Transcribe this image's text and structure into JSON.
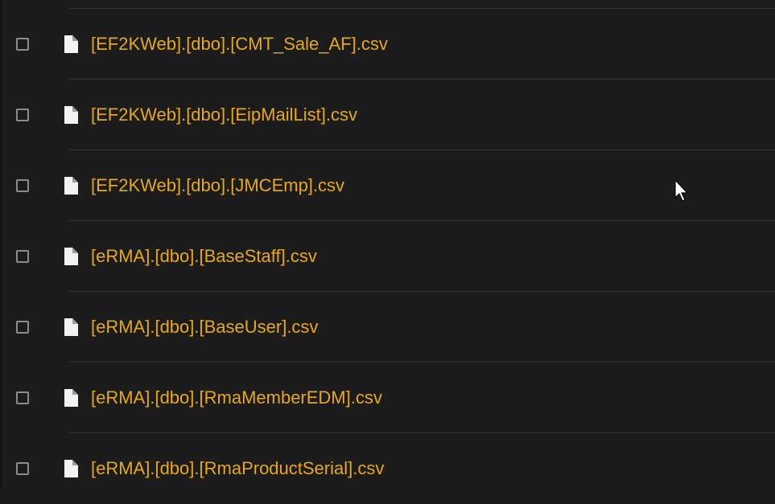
{
  "files": [
    {
      "name": "[EF2KWeb].[dbo].[CMT_Sale_AF].csv",
      "checked": false,
      "icon": "file-icon"
    },
    {
      "name": "[EF2KWeb].[dbo].[EipMailList].csv",
      "checked": false,
      "icon": "file-icon"
    },
    {
      "name": "[EF2KWeb].[dbo].[JMCEmp].csv",
      "checked": false,
      "icon": "file-icon"
    },
    {
      "name": "[eRMA].[dbo].[BaseStaff].csv",
      "checked": false,
      "icon": "file-icon"
    },
    {
      "name": "[eRMA].[dbo].[BaseUser].csv",
      "checked": false,
      "icon": "file-icon"
    },
    {
      "name": "[eRMA].[dbo].[RmaMemberEDM].csv",
      "checked": false,
      "icon": "file-icon"
    },
    {
      "name": "[eRMA].[dbo].[RmaProductSerial].csv",
      "checked": false,
      "icon": "file-icon"
    }
  ],
  "colors": {
    "background": "#1c1c1c",
    "link": "#e8a626",
    "divider": "#333333",
    "checkbox_border": "#8c8c8c",
    "icon": "#f2f2f2"
  }
}
